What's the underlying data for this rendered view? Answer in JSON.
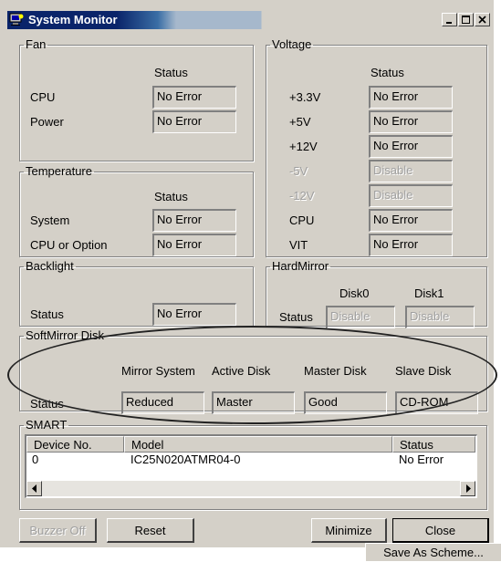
{
  "window": {
    "title": "System Monitor"
  },
  "fan": {
    "legend": "Fan",
    "status_header": "Status",
    "rows": [
      {
        "label": "CPU",
        "status": "No Error"
      },
      {
        "label": "Power",
        "status": "No Error"
      }
    ]
  },
  "temperature": {
    "legend": "Temperature",
    "status_header": "Status",
    "rows": [
      {
        "label": "System",
        "status": "No Error"
      },
      {
        "label": "CPU or Option",
        "status": "No Error"
      }
    ]
  },
  "backlight": {
    "legend": "Backlight",
    "row": {
      "label": "Status",
      "status": "No Error"
    }
  },
  "voltage": {
    "legend": "Voltage",
    "status_header": "Status",
    "rows": [
      {
        "label": "+3.3V",
        "status": "No Error"
      },
      {
        "label": "+5V",
        "status": "No Error"
      },
      {
        "label": "+12V",
        "status": "No Error"
      },
      {
        "label": "-5V",
        "status": "Disable"
      },
      {
        "label": "-12V",
        "status": "Disable"
      },
      {
        "label": "CPU",
        "status": "No Error"
      },
      {
        "label": "VIT",
        "status": "No Error"
      }
    ]
  },
  "hardmirror": {
    "legend": "HardMirror",
    "disk0_header": "Disk0",
    "disk1_header": "Disk1",
    "row_label": "Status",
    "disk0_status": "Disable",
    "disk1_status": "Disable"
  },
  "softmirror": {
    "legend": "SoftMirror Disk",
    "headers": [
      "Mirror System",
      "Active Disk",
      "Master Disk",
      "Slave Disk"
    ],
    "row_label": "Status",
    "values": [
      "Reduced",
      "Master",
      "Good",
      "CD-ROM"
    ]
  },
  "smart": {
    "legend": "SMART",
    "columns": [
      "Device No.",
      "Model",
      "Status"
    ],
    "rows": [
      {
        "device": "0",
        "model": "IC25N020ATMR04-0",
        "status": "No Error"
      }
    ]
  },
  "buttons": {
    "buzzer_off": "Buzzer Off",
    "reset": "Reset",
    "minimize": "Minimize",
    "close": "Close"
  },
  "tooltip": "Save As Scheme...",
  "colors": {
    "title_active": "#0a246a",
    "face": "#d4d0c8",
    "shadow": "#808080",
    "disabled_text": "#a0a0a0"
  }
}
